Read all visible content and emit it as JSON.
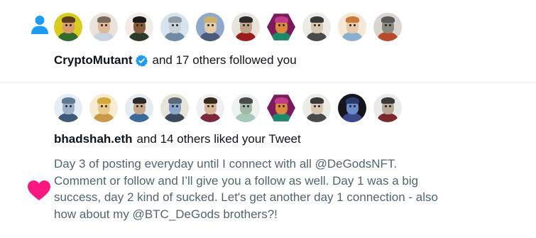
{
  "colors": {
    "follow_icon": "#1d9bf0",
    "like_icon": "#f91880",
    "verified": "#1d9bf0",
    "text_primary": "#0f1419",
    "text_secondary": "#536471",
    "divider": "#eff3f4"
  },
  "notifications": [
    {
      "type": "follow",
      "icon": "person-icon",
      "avatars": [
        {
          "bg": "#d9cc1e",
          "face": "#d99a6c",
          "hair": "#5a3d1c",
          "body": "#2f6b2f",
          "hex": false
        },
        {
          "bg": "#e9e3da",
          "face": "#e0b89a",
          "hair": "#7a6a5a",
          "body": "#c8d4e0",
          "hex": false
        },
        {
          "bg": "#f2ece4",
          "face": "#8a5a3c",
          "hair": "#1a1a1a",
          "body": "#2b3a2b",
          "hex": false
        },
        {
          "bg": "#d6e4ef",
          "face": "#c9d2db",
          "hair": "#8f9aa5",
          "body": "#6f8ba3",
          "hex": false
        },
        {
          "bg": "#8fa8cc",
          "face": "#e6c9a8",
          "hair": "#c8b26a",
          "body": "#4a5a7a",
          "hex": false
        },
        {
          "bg": "#e8e4dc",
          "face": "#bfa38a",
          "hair": "#2a2a2a",
          "body": "#9a1c1c",
          "hex": false
        },
        {
          "bg": "#7a1c5c",
          "face": "#d98a3a",
          "hair": "#c23a8a",
          "body": "#1c8a6a",
          "hex": true
        },
        {
          "bg": "#ecebe6",
          "face": "#d9c7b0",
          "hair": "#3a3a3a",
          "body": "#4a4a4a",
          "hex": false
        },
        {
          "bg": "#f5e9d6",
          "face": "#e8c9a8",
          "hair": "#c97a3a",
          "body": "#8ab0cf",
          "hex": false
        },
        {
          "bg": "#d9d6d0",
          "face": "#8a8a80",
          "hair": "#5a5a5a",
          "body": "#b84a2a",
          "hex": false
        }
      ],
      "username": "CryptoMutant",
      "verified": true,
      "rest": "and 17 others followed you"
    },
    {
      "type": "like",
      "icon": "heart-icon",
      "avatars": [
        {
          "bg": "#e6edf5",
          "face": "#9fb3c8",
          "hair": "#5f7a96",
          "body": "#3f5a76",
          "hex": false
        },
        {
          "bg": "#f6ecd2",
          "face": "#e9c98a",
          "hair": "#d6a83a",
          "body": "#c89a4a",
          "hex": false
        },
        {
          "bg": "#e4ecf2",
          "face": "#c9a88a",
          "hair": "#2a2a2a",
          "body": "#3a6a9a",
          "hex": false
        },
        {
          "bg": "#e8e4da",
          "face": "#8aa6c8",
          "hair": "#5a6a7a",
          "body": "#3a4a5a",
          "hex": false
        },
        {
          "bg": "#f0f0f2",
          "face": "#d9b89a",
          "hair": "#3a2a1a",
          "body": "#7a2a3a",
          "hex": false
        },
        {
          "bg": "#eef2f0",
          "face": "#9fb8a8",
          "hair": "#4a4a4a",
          "body": "#a8c8b8",
          "hex": false
        },
        {
          "bg": "#7a1c5c",
          "face": "#d98a3a",
          "hair": "#c23a8a",
          "body": "#1c8a6a",
          "hex": true
        },
        {
          "bg": "#ecebe6",
          "face": "#d9c7b0",
          "hair": "#3a3a3a",
          "body": "#4a4a4a",
          "hex": false
        },
        {
          "bg": "#14161c",
          "face": "#6a8ac8",
          "hair": "#2a3a6a",
          "body": "#3a4a8a",
          "hex": false
        },
        {
          "bg": "#e8ebe8",
          "face": "#b8a89a",
          "hair": "#3a3a3a",
          "body": "#7a2a2a",
          "hex": false
        }
      ],
      "username": "bhadshah.eth",
      "verified": false,
      "rest": "and 14 others liked your Tweet",
      "tweet": "Day 3 of posting everyday until I connect with all @DeGodsNFT. Comment or follow and I’ll give you a follow as well. Day 1 was a big success, day 2 kind of sucked. Let's get another day 1 connection - also how about my @BTC_DeGods brothers?!"
    }
  ]
}
